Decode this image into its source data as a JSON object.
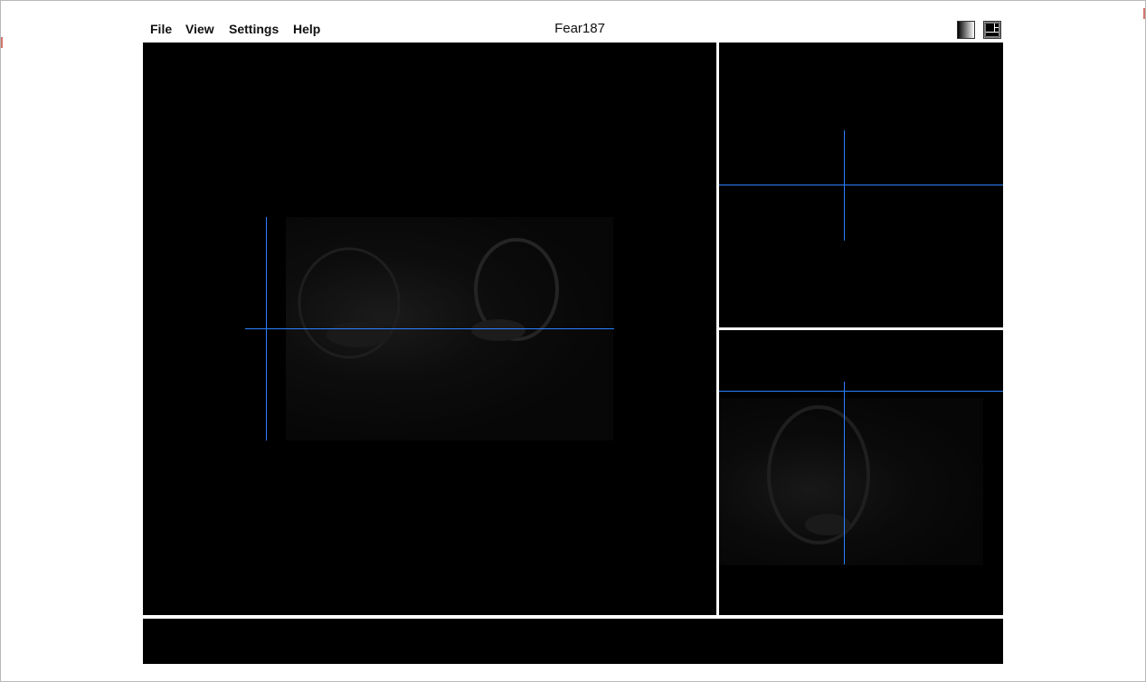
{
  "window": {
    "title": "Fear187"
  },
  "menu": {
    "items": [
      {
        "label": "File"
      },
      {
        "label": "View"
      },
      {
        "label": "Settings"
      },
      {
        "label": "Help"
      }
    ]
  },
  "toolbar": {
    "icons": [
      "contrast-gradient-icon",
      "layout-toggle-icon"
    ]
  },
  "colors": {
    "crosshair": "#2b7fff",
    "viewport_background": "#000000",
    "separator": "#ffffff"
  },
  "viewports": {
    "main": {
      "name": "axial-view"
    },
    "top_right": {
      "name": "sagittal-view"
    },
    "bottom_right": {
      "name": "coronal-view"
    }
  },
  "status_bar": {
    "text": ""
  }
}
